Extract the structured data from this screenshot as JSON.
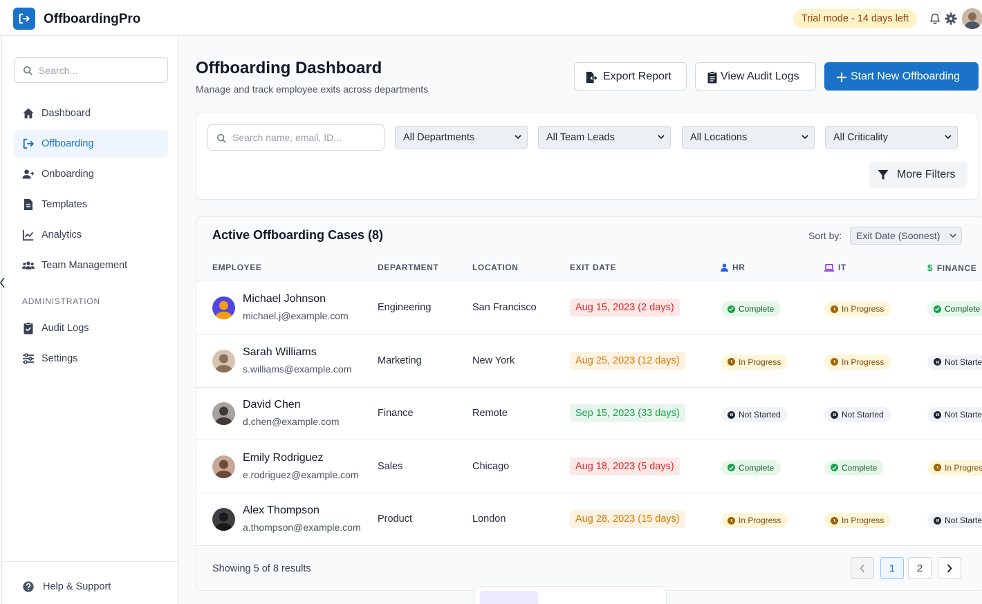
{
  "app": {
    "title": "OffboardingPro",
    "trial": "Trial mode - 14 days left"
  },
  "sidebar": {
    "search_placeholder": "Search...",
    "items": [
      {
        "label": "Dashboard",
        "icon": "home-icon"
      },
      {
        "label": "Offboarding",
        "icon": "exit-icon",
        "active": true
      },
      {
        "label": "Onboarding",
        "icon": "user-plus-icon"
      },
      {
        "label": "Templates",
        "icon": "file-icon"
      },
      {
        "label": "Analytics",
        "icon": "chart-line-icon"
      },
      {
        "label": "Team Management",
        "icon": "users-icon"
      }
    ],
    "section": "ADMINISTRATION",
    "admin_items": [
      {
        "label": "Audit Logs",
        "icon": "clipboard-icon"
      },
      {
        "label": "Settings",
        "icon": "sliders-icon"
      }
    ],
    "help": "Help & Support"
  },
  "page": {
    "title": "Offboarding Dashboard",
    "subtitle": "Manage and track employee exits across departments",
    "export_label": "Export Report",
    "audit_label": "View Audit Logs",
    "start_label": "Start New Offboarding"
  },
  "filters": {
    "search_placeholder": "Search name, email, ID...",
    "department": "All Departments",
    "team_lead": "All Team Leads",
    "location": "All Locations",
    "criticality": "All Criticality",
    "more": "More Filters"
  },
  "table": {
    "title": "Active Offboarding Cases (8)",
    "sort_label": "Sort by:",
    "sort_value": "Exit Date (Soonest)",
    "headers": {
      "employee": "EMPLOYEE",
      "department": "DEPARTMENT",
      "location": "LOCATION",
      "exit": "EXIT DATE",
      "hr": "HR",
      "it": "IT",
      "finance": "FINANCE"
    },
    "rows": [
      {
        "name": "Michael Johnson",
        "email": "michael.j@example.com",
        "department": "Engineering",
        "location": "San Francisco",
        "exit": "Aug 15, 2023 (2 days)",
        "exit_tone": "red",
        "hr": "Complete",
        "it": "In Progress",
        "finance": "Complete"
      },
      {
        "name": "Sarah Williams",
        "email": "s.williams@example.com",
        "department": "Marketing",
        "location": "New York",
        "exit": "Aug 25, 2023 (12 days)",
        "exit_tone": "orange",
        "hr": "In Progress",
        "it": "In Progress",
        "finance": "Not Started"
      },
      {
        "name": "David Chen",
        "email": "d.chen@example.com",
        "department": "Finance",
        "location": "Remote",
        "exit": "Sep 15, 2023 (33 days)",
        "exit_tone": "green",
        "hr": "Not Started",
        "it": "Not Started",
        "finance": "Not Started"
      },
      {
        "name": "Emily Rodriguez",
        "email": "e.rodriguez@example.com",
        "department": "Sales",
        "location": "Chicago",
        "exit": "Aug 18, 2023 (5 days)",
        "exit_tone": "red",
        "hr": "Complete",
        "it": "Complete",
        "finance": "In Progress"
      },
      {
        "name": "Alex Thompson",
        "email": "a.thompson@example.com",
        "department": "Product",
        "location": "London",
        "exit": "Aug 28, 2023 (15 days)",
        "exit_tone": "orange",
        "hr": "In Progress",
        "it": "In Progress",
        "finance": "Not Started"
      }
    ],
    "showing": "Showing 5 of 8 results",
    "pages": [
      "1",
      "2"
    ]
  },
  "colors": {
    "accent": "#1a73c8",
    "danger": "#dc2626",
    "warning": "#d97706",
    "success": "#16a34a"
  }
}
